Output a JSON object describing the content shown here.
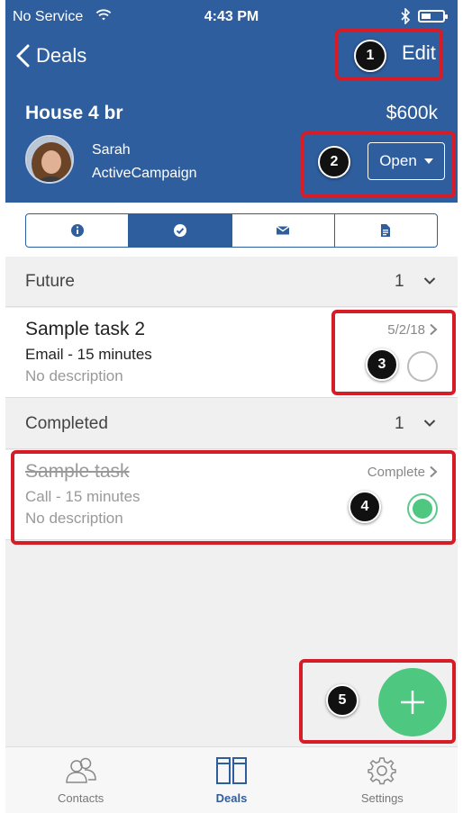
{
  "status_bar": {
    "carrier": "No Service",
    "time": "4:43 PM"
  },
  "nav": {
    "back_label": "Deals",
    "edit_label": "Edit"
  },
  "deal": {
    "title": "House 4 br",
    "value": "$600k",
    "contact_name": "Sarah",
    "contact_org": "ActiveCampaign",
    "status": "Open"
  },
  "tabs": [
    {
      "icon": "info-icon"
    },
    {
      "icon": "check-circle-icon",
      "active": true
    },
    {
      "icon": "mail-icon"
    },
    {
      "icon": "document-icon"
    }
  ],
  "sections": {
    "future": {
      "title": "Future",
      "count": "1"
    },
    "completed": {
      "title": "Completed",
      "count": "1"
    }
  },
  "tasks": {
    "future": [
      {
        "title": "Sample task 2",
        "type": "Email - 15 minutes",
        "description": "No description",
        "meta": "5/2/18",
        "done": false
      }
    ],
    "completed": [
      {
        "title": "Sample task",
        "type": "Call - 15 minutes",
        "description": "No description",
        "meta": "Complete",
        "done": true
      }
    ]
  },
  "callouts": [
    "1",
    "2",
    "3",
    "4",
    "5"
  ],
  "tabbar": {
    "contacts": "Contacts",
    "deals": "Deals",
    "settings": "Settings"
  },
  "colors": {
    "brand_blue": "#2f5e9e",
    "accent_green": "#4ec781",
    "callout_red": "#d61c26"
  }
}
